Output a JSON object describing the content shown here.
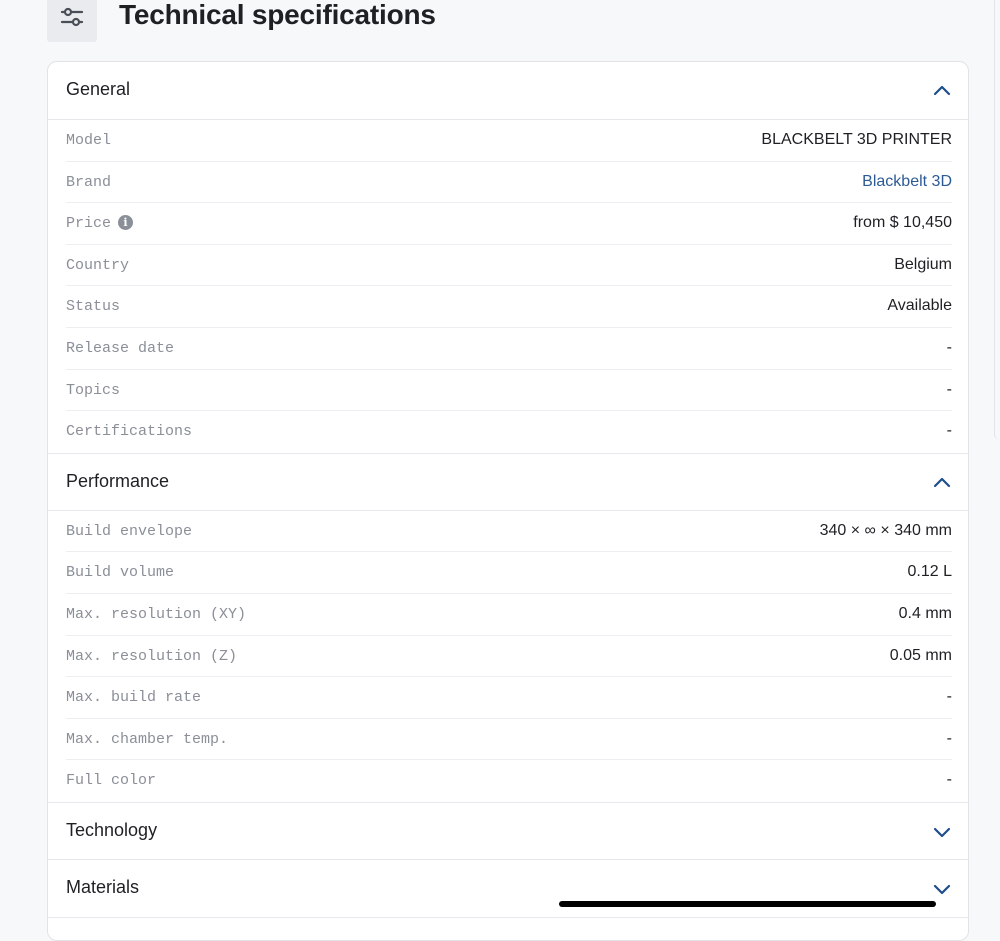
{
  "page": {
    "title": "Technical specifications"
  },
  "icons": {
    "header": "sliders-icon",
    "expanded": "chevron-up-icon",
    "collapsed": "chevron-down-icon",
    "info": "info-icon"
  },
  "colors": {
    "accent": "#1f4e8c",
    "link": "#2d5a95",
    "label": "#8a8f98"
  },
  "sections": {
    "general": {
      "title": "General",
      "expanded": true,
      "rows": [
        {
          "label": "Model",
          "value": "BLACKBELT 3D PRINTER"
        },
        {
          "label": "Brand",
          "value": "Blackbelt 3D"
        },
        {
          "label": "Price",
          "value": "from $ 10,450"
        },
        {
          "label": "Country",
          "value": "Belgium"
        },
        {
          "label": "Status",
          "value": "Available"
        },
        {
          "label": "Release date",
          "value": "-"
        },
        {
          "label": "Topics",
          "value": "-"
        },
        {
          "label": "Certifications",
          "value": "-"
        }
      ]
    },
    "performance": {
      "title": "Performance",
      "expanded": true,
      "rows": [
        {
          "label": "Build envelope",
          "value": "340 × ∞ × 340 mm"
        },
        {
          "label": "Build volume",
          "value": "0.12 L"
        },
        {
          "label": "Max. resolution (XY)",
          "value": "0.4 mm"
        },
        {
          "label": "Max. resolution (Z)",
          "value": "0.05 mm"
        },
        {
          "label": "Max. build rate",
          "value": "-"
        },
        {
          "label": "Max. chamber temp.",
          "value": "-"
        },
        {
          "label": "Full color",
          "value": "-"
        }
      ]
    },
    "technology": {
      "title": "Technology",
      "expanded": false
    },
    "materials": {
      "title": "Materials",
      "expanded": false
    }
  }
}
